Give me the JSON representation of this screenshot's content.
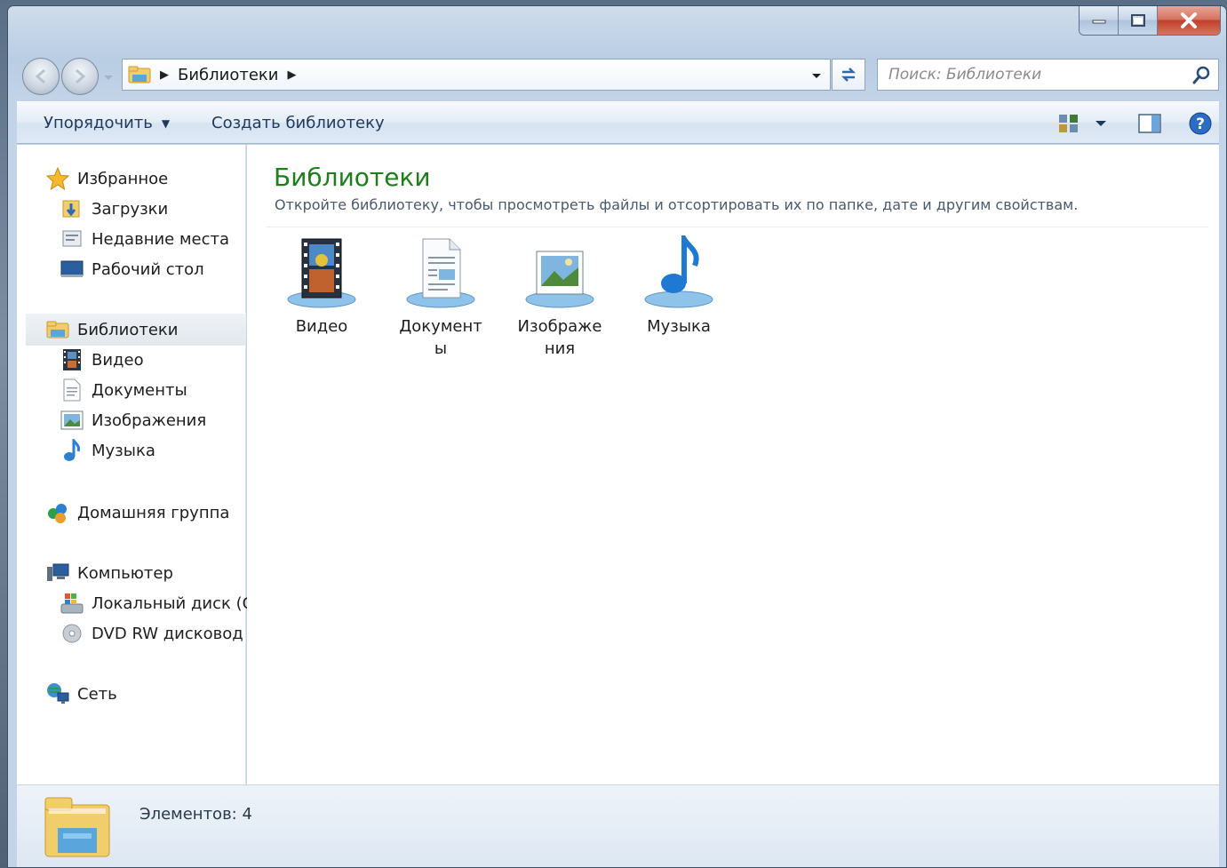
{
  "window": {
    "caption": {
      "minimize_icon": "minimize-icon",
      "maximize_icon": "maximize-icon",
      "close_icon": "close-icon"
    }
  },
  "address_bar": {
    "crumbs": [
      "Библиотеки"
    ],
    "search_placeholder": "Поиск: Библиотеки"
  },
  "command_bar": {
    "organize": "Упорядочить",
    "new_library": "Создать библиотеку"
  },
  "nav_pane": {
    "favorites": {
      "label": "Избранное",
      "items": [
        "Загрузки",
        "Недавние места",
        "Рабочий стол"
      ]
    },
    "libraries": {
      "label": "Библиотеки",
      "items": [
        "Видео",
        "Документы",
        "Изображения",
        "Музыка"
      ]
    },
    "homegroup": "Домашняя группа",
    "computer": {
      "label": "Компьютер",
      "items": [
        "Локальный диск (C",
        "DVD RW дисковод ("
      ]
    },
    "network": "Сеть"
  },
  "content": {
    "title": "Библиотеки",
    "description": "Откройте библиотеку, чтобы просмотреть файлы и отсортировать их по папке, дате и другим свойствам.",
    "tiles": [
      {
        "label": "Видео",
        "icon": "video-library-icon"
      },
      {
        "label": "Документы",
        "icon": "documents-library-icon"
      },
      {
        "label": "Изображения",
        "icon": "pictures-library-icon"
      },
      {
        "label": "Музыка",
        "icon": "music-library-icon"
      }
    ]
  },
  "details": {
    "count": "Элементов: 4"
  },
  "colors": {
    "title_green": "#1e7e1e",
    "command_text": "#1e395b",
    "close_red": "#c0402a"
  }
}
